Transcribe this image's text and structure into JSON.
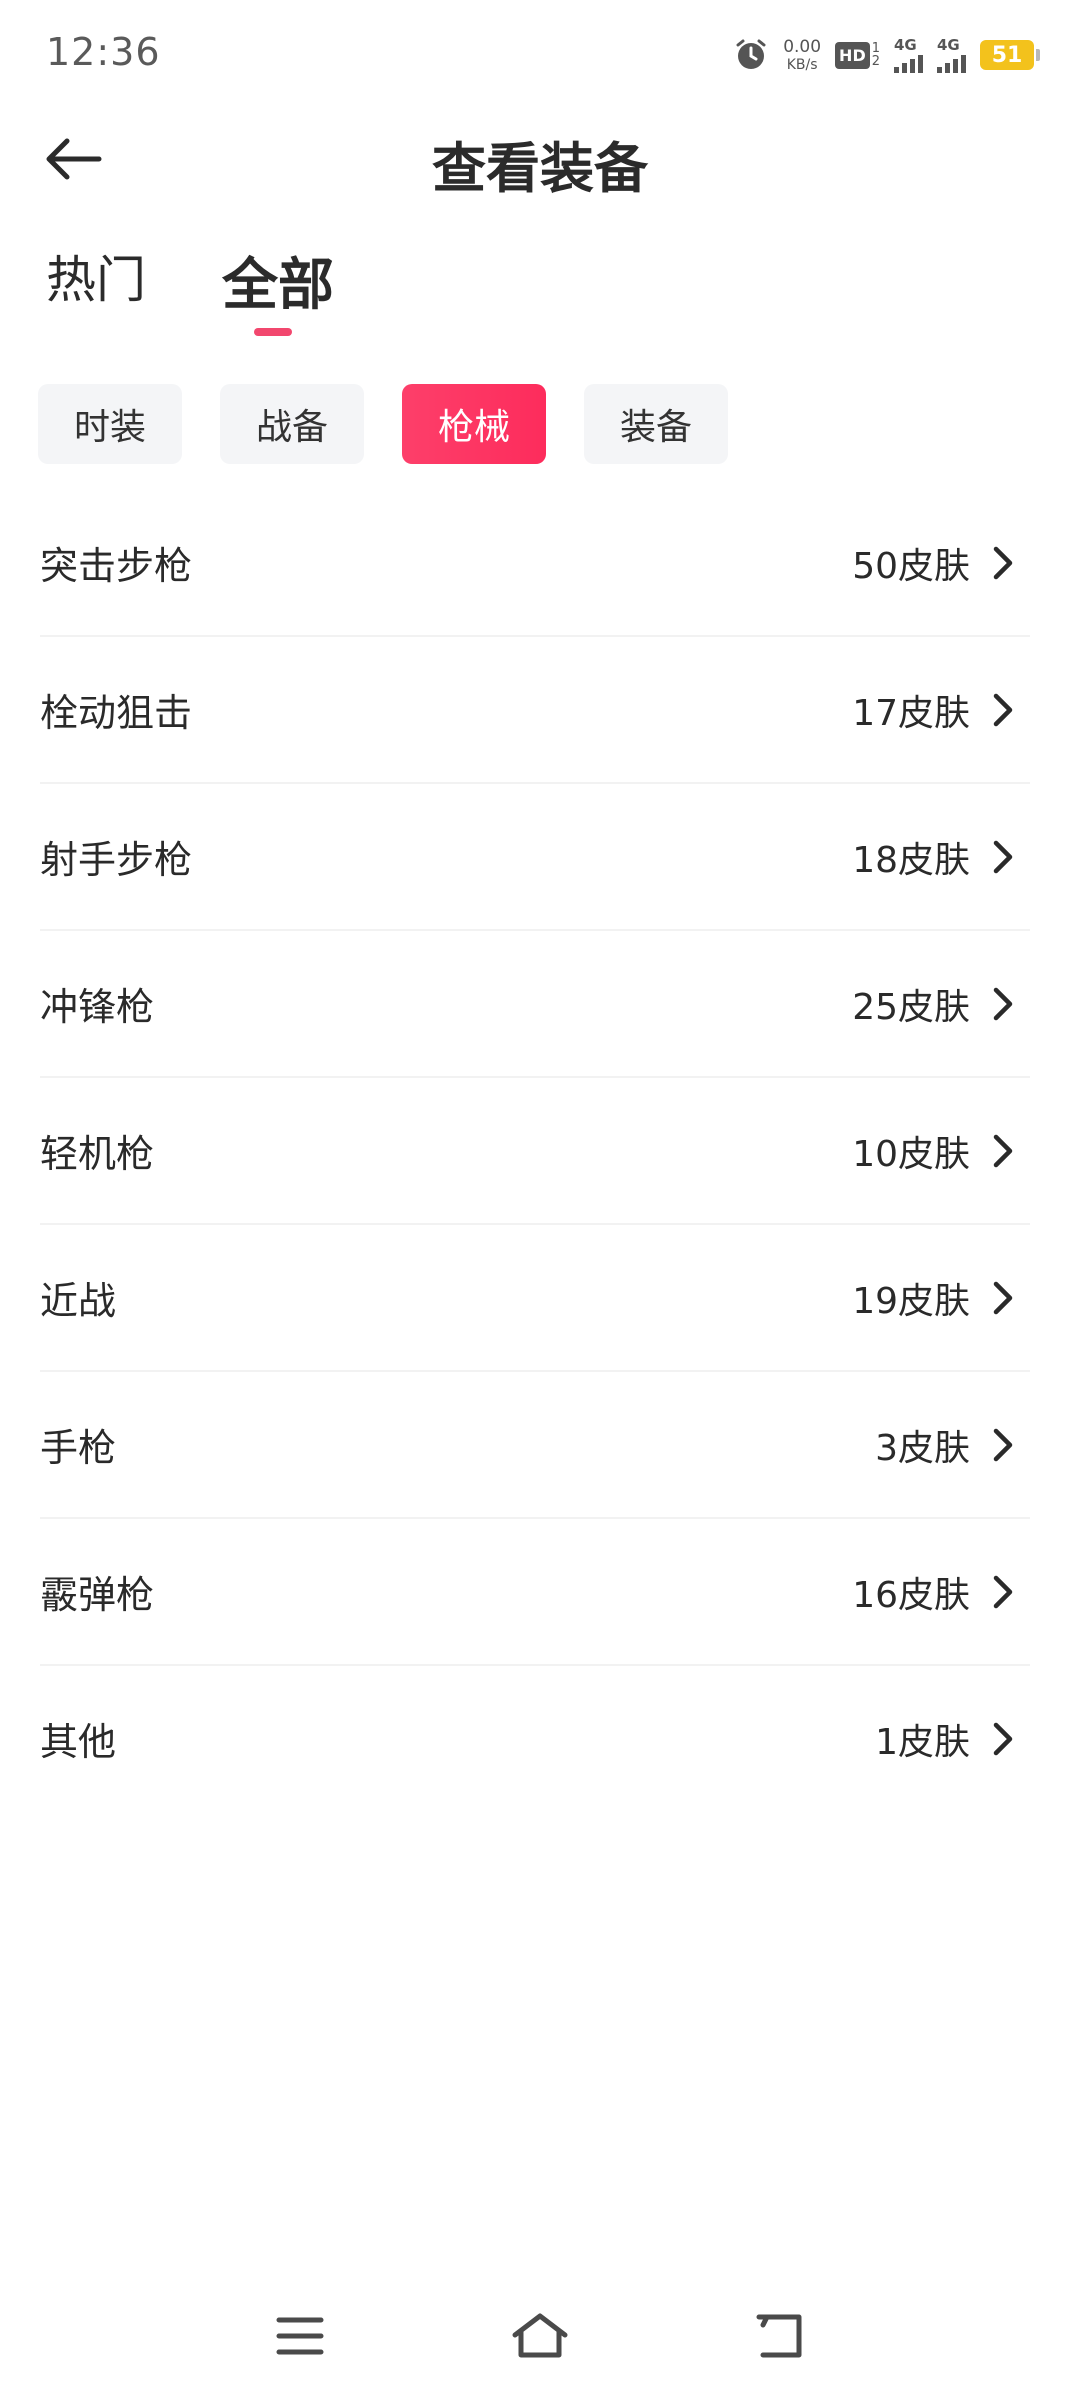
{
  "status_bar": {
    "time": "12:36",
    "net_speed_value": "0.00",
    "net_speed_unit": "KB/s",
    "hd_label": "HD",
    "hd_sub_top": "1",
    "hd_sub_bottom": "2",
    "signal1_label": "4G",
    "signal2_label": "4G",
    "battery": "51",
    "battery_color": "#f3c21c"
  },
  "header": {
    "title": "查看装备"
  },
  "top_tabs": [
    {
      "label": "热门",
      "active": false
    },
    {
      "label": "全部",
      "active": true
    }
  ],
  "chips": [
    {
      "label": "时装",
      "active": false
    },
    {
      "label": "战备",
      "active": false
    },
    {
      "label": "枪械",
      "active": true
    },
    {
      "label": "装备",
      "active": false
    }
  ],
  "list": [
    {
      "label": "突击步枪",
      "count": "50皮肤"
    },
    {
      "label": "栓动狙击",
      "count": "17皮肤"
    },
    {
      "label": "射手步枪",
      "count": "18皮肤"
    },
    {
      "label": "冲锋枪",
      "count": "25皮肤"
    },
    {
      "label": "轻机枪",
      "count": "10皮肤"
    },
    {
      "label": "近战",
      "count": "19皮肤"
    },
    {
      "label": "手枪",
      "count": "3皮肤"
    },
    {
      "label": "霰弹枪",
      "count": "16皮肤"
    },
    {
      "label": "其他",
      "count": "1皮肤"
    }
  ],
  "colors": {
    "accent": "#fd3560",
    "indicator": "#f2476e",
    "chip_bg": "#f4f5f7"
  },
  "icons": {
    "back": "arrow-left-icon",
    "chevron": "chevron-right-icon",
    "nav_menu": "menu-icon",
    "nav_home": "home-icon",
    "nav_back": "back-icon"
  }
}
